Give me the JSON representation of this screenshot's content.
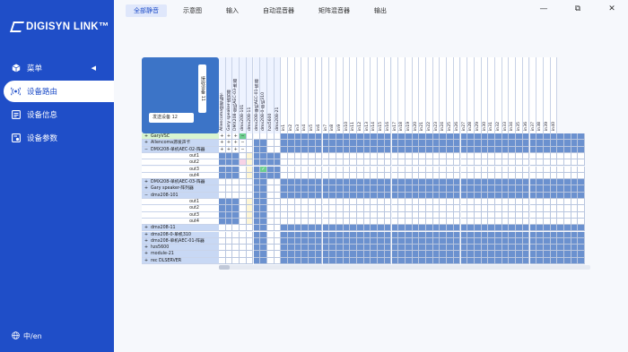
{
  "sidebar": {
    "logo": "DIGISYN LINK™",
    "items": [
      {
        "label": "菜单",
        "icon": "cube-icon"
      },
      {
        "label": "设备路由",
        "icon": "routing-icon"
      },
      {
        "label": "设备信息",
        "icon": "info-icon"
      },
      {
        "label": "设备参数",
        "icon": "params-icon"
      }
    ],
    "language": "中/en"
  },
  "tabs": [
    "全部静音",
    "示意图",
    "输入",
    "自动混音器",
    "矩阵混音器",
    "输出"
  ],
  "window": {
    "minimize": "—",
    "restore": "⧉",
    "close": "✕"
  },
  "corner": {
    "receive": "接收设备 11",
    "send": "发送设备 12"
  },
  "columns": {
    "devices": [
      "Allencoma接收板卡",
      "Gary speaker-阵列器",
      "DMX208-单机AEC-03-阵器",
      "dmx208-101",
      "dmx208-11",
      "dmx208-单机AEC-01-阵器",
      "dmx208-0-单机310",
      "hzs5600",
      "dmx208-21"
    ],
    "subs": [
      "in1",
      "in2",
      "in3",
      "in4",
      "in5",
      "in6",
      "in7",
      "in8",
      "in9",
      "in10",
      "in11",
      "in12",
      "in13",
      "in14",
      "in15",
      "in16",
      "in17",
      "in18",
      "in19",
      "in20",
      "in21",
      "in22",
      "in23",
      "in24",
      "in25",
      "in26",
      "in27",
      "in28",
      "in29",
      "in30",
      "in31",
      "in32",
      "in33",
      "in34",
      "in35",
      "in36",
      "in37",
      "in38",
      "in39",
      "in40"
    ]
  },
  "rows": [
    {
      "type": "device",
      "pm": "+",
      "label": "GaryVSC",
      "first": true
    },
    {
      "type": "device",
      "pm": "+",
      "label": "Allencoma源发声卡"
    },
    {
      "type": "device",
      "pm": "−",
      "label": "DMX208-单机AEC-02-阵器"
    },
    {
      "type": "port",
      "label": "out1"
    },
    {
      "type": "port",
      "label": "out2"
    },
    {
      "type": "port",
      "label": "out3"
    },
    {
      "type": "port",
      "label": "out4"
    },
    {
      "type": "device",
      "pm": "+",
      "label": "DMX208-单机AEC-03-阵器"
    },
    {
      "type": "device",
      "pm": "+",
      "label": "Gary speaker-阵列器"
    },
    {
      "type": "device",
      "pm": "−",
      "label": "dmx208-101"
    },
    {
      "type": "port",
      "label": "out1"
    },
    {
      "type": "port",
      "label": "out2"
    },
    {
      "type": "port",
      "label": "out3"
    },
    {
      "type": "port",
      "label": "out4"
    },
    {
      "type": "device",
      "pm": "+",
      "label": "dmx208-11"
    },
    {
      "type": "device",
      "pm": "+",
      "label": "dmx208-0-单机310"
    },
    {
      "type": "device",
      "pm": "+",
      "label": "dmx208-单机AEC-01-阵器"
    },
    {
      "type": "device",
      "pm": "+",
      "label": "hzs5600"
    },
    {
      "type": "device",
      "pm": "+",
      "label": "module-21"
    },
    {
      "type": "device",
      "pm": "+",
      "label": "rec DLSERVER"
    }
  ],
  "colors": {
    "sidebar": "#1f4ec8",
    "cell_dark": "#6b91cf",
    "cell_light": "#ffffff",
    "cell_yellow": "#fff7d6",
    "cell_pink": "#f7d3e6",
    "cell_green": "#6ccf8f"
  }
}
